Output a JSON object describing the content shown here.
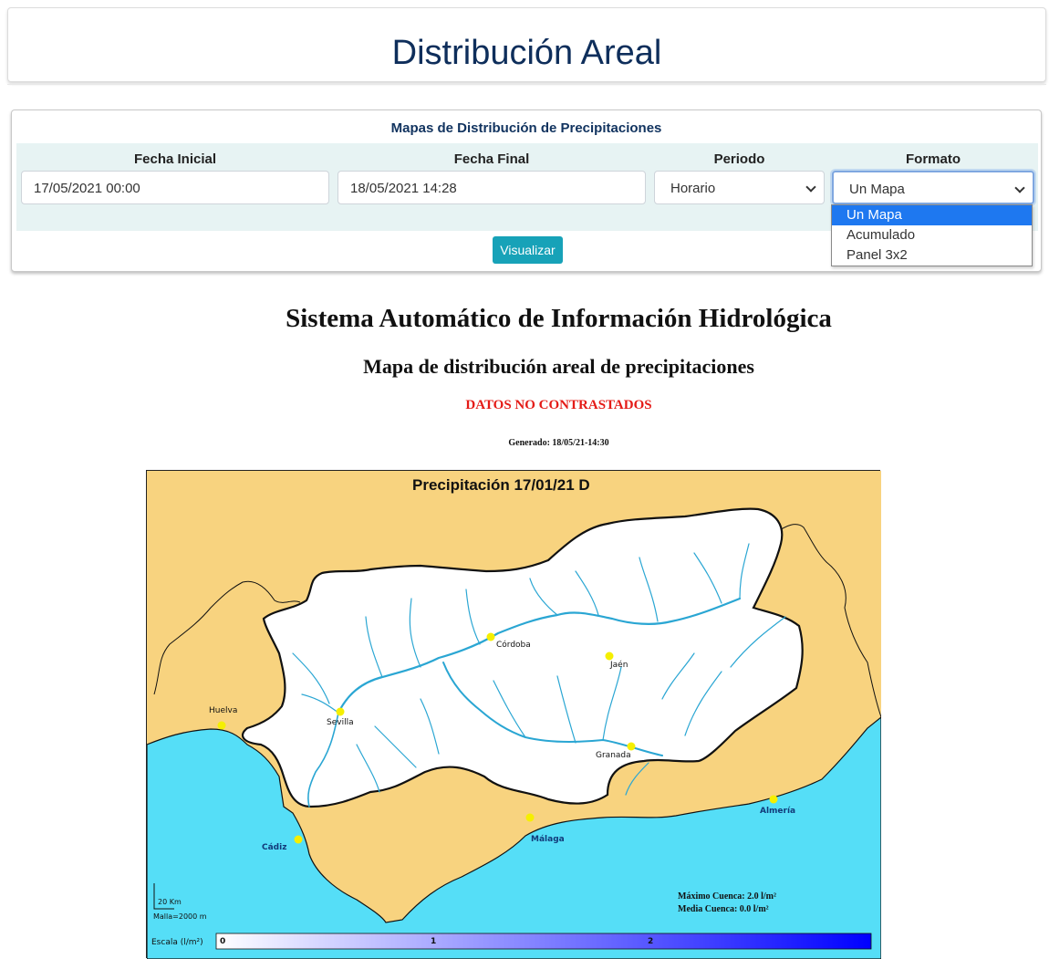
{
  "header": {
    "title": "Distribución Areal"
  },
  "form": {
    "title": "Mapas de Distribución de Precipitaciones",
    "fecha_inicial": {
      "label": "Fecha Inicial",
      "value": "17/05/2021 00:00"
    },
    "fecha_final": {
      "label": "Fecha Final",
      "value": "18/05/2021 14:28"
    },
    "periodo": {
      "label": "Periodo",
      "value": "Horario"
    },
    "formato": {
      "label": "Formato",
      "value": "Un Mapa",
      "options": [
        "Un Mapa",
        "Acumulado",
        "Panel 3x2"
      ]
    },
    "submit_label": "Visualizar"
  },
  "report": {
    "title": "Sistema Automático de Información Hidrológica",
    "subtitle": "Mapa de distribución areal de precipitaciones",
    "warning": "DATOS NO CONTRASTADOS",
    "generated": "Generado: 18/05/21-14:30"
  },
  "map": {
    "title": "Precipitación 17/01/21 D",
    "cities": {
      "cordoba": "Córdoba",
      "jaen": "Jaén",
      "huelva": "Huelva",
      "sevilla": "Sevilla",
      "granada": "Granada",
      "almeria": "Almería",
      "malaga": "Málaga",
      "cadiz": "Cádiz"
    },
    "max_cuenca": "Máximo Cuenca: 2.0 l/m²",
    "media_cuenca": "Media Cuenca:   0.0 l/m²",
    "scale_bar": "20 Km",
    "malla": "Malla=2000 m",
    "legend": {
      "label": "Escala (l/m²)",
      "ticks": [
        "0",
        "1",
        "2"
      ]
    },
    "colors": {
      "land": "#f8d37f",
      "sea": "#55def7",
      "basin": "#ffffff",
      "river": "#2aa6d3",
      "city": "#f5ef00",
      "scale_start": "#ffffff",
      "scale_end": "#0000ff"
    }
  }
}
